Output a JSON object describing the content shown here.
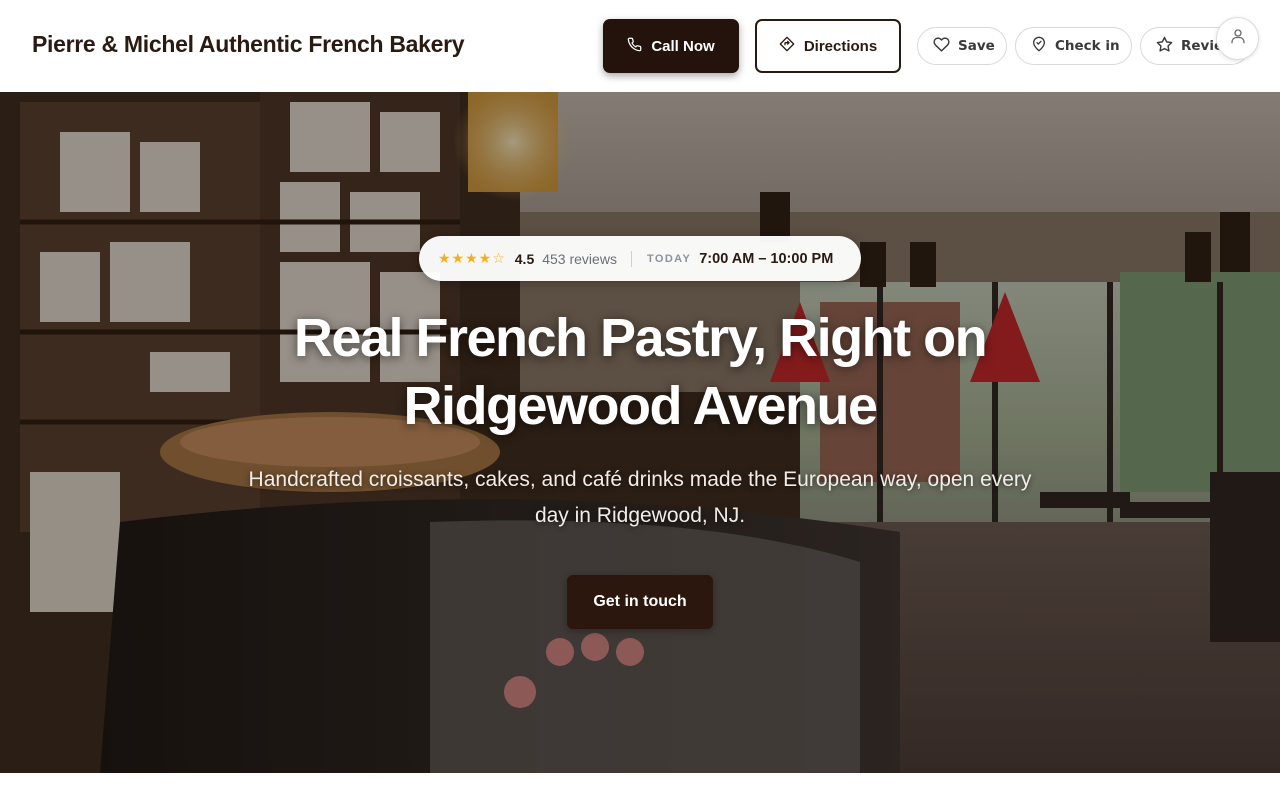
{
  "header": {
    "brand": "Pierre & Michel Authentic French Bakery",
    "call_label": "Call Now",
    "directions_label": "Directions",
    "save_label": "Save",
    "checkin_label": "Check in",
    "review_label": "Review"
  },
  "hero": {
    "rating": {
      "stars": "★★★★☆",
      "value": "4.5",
      "reviews": "453 reviews",
      "today_label": "TODAY",
      "hours": "7:00 AM – 10:00 PM",
      "star_color": "#f2b01e"
    },
    "headline_line1": "Real French Pastry, Right on",
    "headline_line2": "Ridgewood Avenue",
    "subhead_line1": "Handcrafted croissants, cakes, and café drinks made the European way, open every",
    "subhead_line2": "day in Ridgewood, NJ.",
    "cta_label": "Get in touch"
  },
  "icons": {
    "call": "phone-icon",
    "directions": "directions-icon",
    "save": "heart-icon",
    "checkin": "map-pin-icon",
    "review": "star-outline-icon",
    "account": "user-icon"
  },
  "colors": {
    "brand_dark": "#24120c",
    "text_dark": "#2a1a12",
    "accent_star": "#f2b01e"
  }
}
